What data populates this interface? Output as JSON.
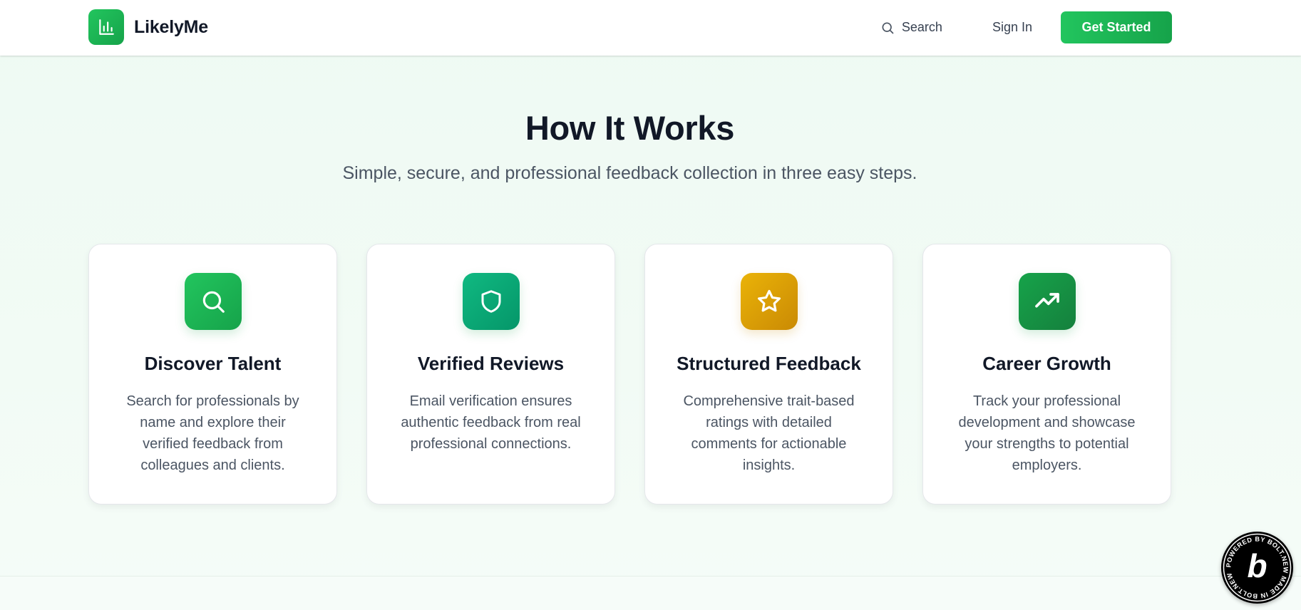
{
  "header": {
    "brand": "LikelyMe",
    "brand_icon": "bar-chart-icon",
    "search_label": "Search",
    "signin_label": "Sign In",
    "cta_label": "Get Started"
  },
  "section": {
    "title": "How It Works",
    "subtitle": "Simple, secure, and professional feedback collection in three easy steps."
  },
  "cards": [
    {
      "icon": "search-icon",
      "title": "Discover Talent",
      "description": "Search for professionals by name and explore their verified feedback from colleagues and clients."
    },
    {
      "icon": "shield-icon",
      "title": "Verified Reviews",
      "description": "Email verification ensures authentic feedback from real professional connections."
    },
    {
      "icon": "star-icon",
      "title": "Structured Feedback",
      "description": "Comprehensive trait-based ratings with detailed comments for actionable insights."
    },
    {
      "icon": "trending-up-icon",
      "title": "Career Growth",
      "description": "Track your professional development and showcase your strengths to potential employers."
    }
  ],
  "badge": {
    "text": "POWERED BY BOLT.NEW MADE IN BOLT.NEW",
    "letter": "b"
  },
  "colors": {
    "accent": "#22c55e",
    "accent_dark": "#16a34a",
    "teal": "#10b981",
    "amber": "#eab308"
  }
}
